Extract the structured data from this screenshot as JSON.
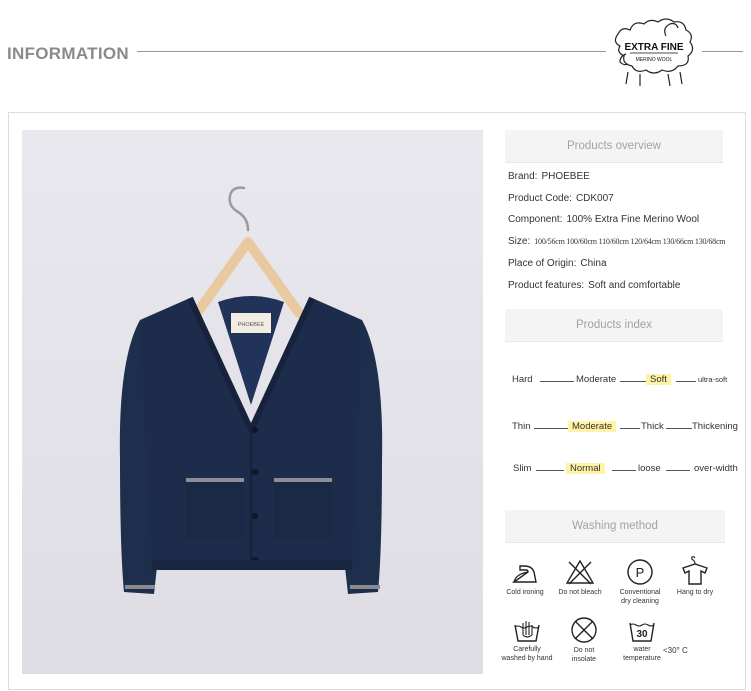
{
  "header": {
    "title": "INFORMATION",
    "logo": {
      "line1": "EXTRA FINE",
      "line2": "MERINO WOOL"
    }
  },
  "product_image": {
    "tag_text": "PHOEBEE"
  },
  "overview": {
    "heading": "Products overview",
    "rows": [
      {
        "key": "Brand:",
        "value": "PHOEBEE"
      },
      {
        "key": "Product Code:",
        "value": "CDK007"
      },
      {
        "key": "Component:",
        "value": "100% Extra Fine Merino Wool"
      },
      {
        "key": "Size:",
        "value": "100/56cm 100/60cm 110/60cm 120/64cm 130/66cm 130/68cm"
      },
      {
        "key": "Place of Origin:",
        "value": "China"
      },
      {
        "key": "Product features:",
        "value": "Soft and comfortable"
      }
    ]
  },
  "index": {
    "heading": "Products index",
    "hardness": {
      "a": "Hard",
      "b": "Moderate",
      "c": "Soft",
      "d": "ultra-soft",
      "selected": "Soft"
    },
    "thickness": {
      "a": "Thin",
      "b": "Moderate",
      "c": "Thick",
      "d": "Thickening",
      "selected": "Moderate"
    },
    "fit": {
      "a": "Slim",
      "b": "Normal",
      "c": "loose",
      "d": "over-width",
      "selected": "Normal"
    }
  },
  "washing": {
    "heading": "Washing method",
    "items": [
      {
        "icon": "iron-icon",
        "label1": "Cold ironing",
        "label2": ""
      },
      {
        "icon": "no-bleach-icon",
        "label1": "Do not bleach",
        "label2": ""
      },
      {
        "icon": "dry-clean-icon",
        "symbol": "P",
        "label1": "Conventional",
        "label2": "dry cleaning"
      },
      {
        "icon": "hang-dry-icon",
        "label1": "Hang to dry",
        "label2": ""
      },
      {
        "icon": "hand-wash-icon",
        "label1": "Carefully",
        "label2": "washed by hand"
      },
      {
        "icon": "no-insolate-icon",
        "label1": "Do not",
        "label2": "insolate"
      },
      {
        "icon": "water-temp-icon",
        "symbol": "30",
        "label1": "water",
        "label2": "temperature",
        "side": "<30° C"
      }
    ]
  }
}
